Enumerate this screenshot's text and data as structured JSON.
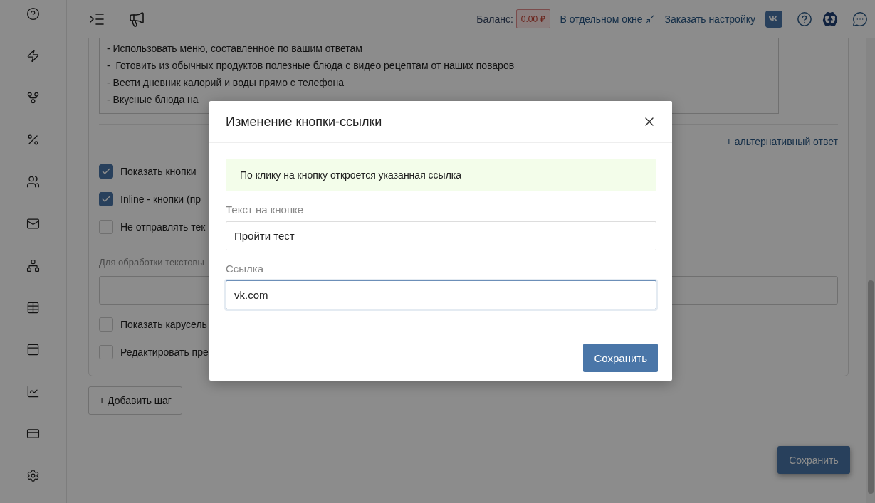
{
  "topbar": {
    "balance_label": "Баланс:",
    "balance": "0.00 ₽",
    "separate_window": "В отдельном окне",
    "order_setup": "Заказать настройку"
  },
  "message_lines": [
    "- Использовать меню, составленное по вашим ответам",
    "-  Готовить из обычных продуктов полезные блюда с видео рецептам от наших поваров",
    "- Вести дневник калорий и воды прямо с телефона",
    "- Вкусные блюда на"
  ],
  "alt_answer_link": "+ альтернативный ответ",
  "options_top": [
    {
      "label": "Показать кнопки",
      "checked": true
    },
    {
      "label": "Inline - кнопки (пр",
      "checked": true
    },
    {
      "label": "Не отправлять тек",
      "checked": false
    }
  ],
  "text_processing_label": "Для обработки текстовы",
  "options_bottom": [
    {
      "label": "Показать карусель",
      "checked": false
    },
    {
      "label": "Редактировать пре",
      "checked": false
    }
  ],
  "add_step_button": "+ Добавить шаг",
  "save_button": "Сохранить",
  "modal": {
    "title": "Изменение кнопки-ссылки",
    "info": "По клику на кнопку откроется указанная ссылка",
    "fields": [
      {
        "label": "Текст на кнопке",
        "value": "Пройти тест",
        "focused": false
      },
      {
        "label": "Ссылка",
        "value": "vk.com",
        "focused": true
      }
    ],
    "save_button": "Сохранить"
  }
}
